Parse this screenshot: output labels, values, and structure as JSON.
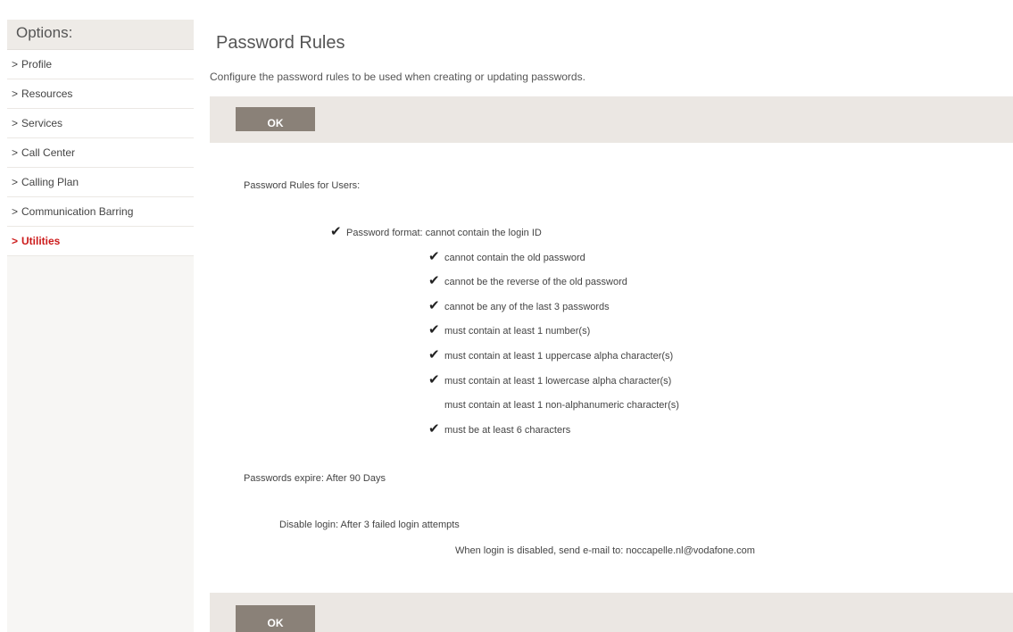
{
  "sidebar": {
    "header": "Options:",
    "items": [
      {
        "prefix": ">",
        "label": "Profile",
        "active": false
      },
      {
        "prefix": ">",
        "label": "Resources",
        "active": false
      },
      {
        "prefix": ">",
        "label": "Services",
        "active": false
      },
      {
        "prefix": ">",
        "label": "Call Center",
        "active": false
      },
      {
        "prefix": ">",
        "label": "Calling Plan",
        "active": false
      },
      {
        "prefix": ">",
        "label": "Communication Barring",
        "active": false
      },
      {
        "prefix": ">",
        "label": "Utilities",
        "active": true
      }
    ]
  },
  "main": {
    "title": "Password Rules",
    "description": "Configure the password rules to be used when creating or updating passwords.",
    "ok_label": "OK",
    "section_label": "Password Rules for Users:",
    "format_label": "Password format:",
    "rules": [
      {
        "text": "cannot contain the login ID",
        "checked": true
      },
      {
        "text": "cannot contain the old password",
        "checked": true
      },
      {
        "text": "cannot be the reverse of the old password",
        "checked": true
      },
      {
        "text": "cannot be any of the last 3 passwords",
        "checked": true
      },
      {
        "text": "must contain at least 1 number(s)",
        "checked": true
      },
      {
        "text": "must contain at least 1 uppercase alpha character(s)",
        "checked": true
      },
      {
        "text": "must contain at least 1 lowercase alpha character(s)",
        "checked": true
      },
      {
        "text": "must contain at least 1 non-alphanumeric character(s)",
        "checked": false
      },
      {
        "text": "must be at least 6 characters",
        "checked": true
      }
    ],
    "expire_label": "Passwords expire:",
    "expire_value": "After 90 Days",
    "disable_label": "Disable login:",
    "disable_value": "After 3 failed login attempts",
    "email_label": "When login is disabled, send e-mail to:",
    "email_value": "noccapelle.nl@vodafone.com"
  },
  "icons": {
    "check": "checkmark-icon"
  },
  "colors": {
    "active_link": "#cc1b1b",
    "button_bg": "#8a8178",
    "bar_bg": "#ebe7e3"
  }
}
